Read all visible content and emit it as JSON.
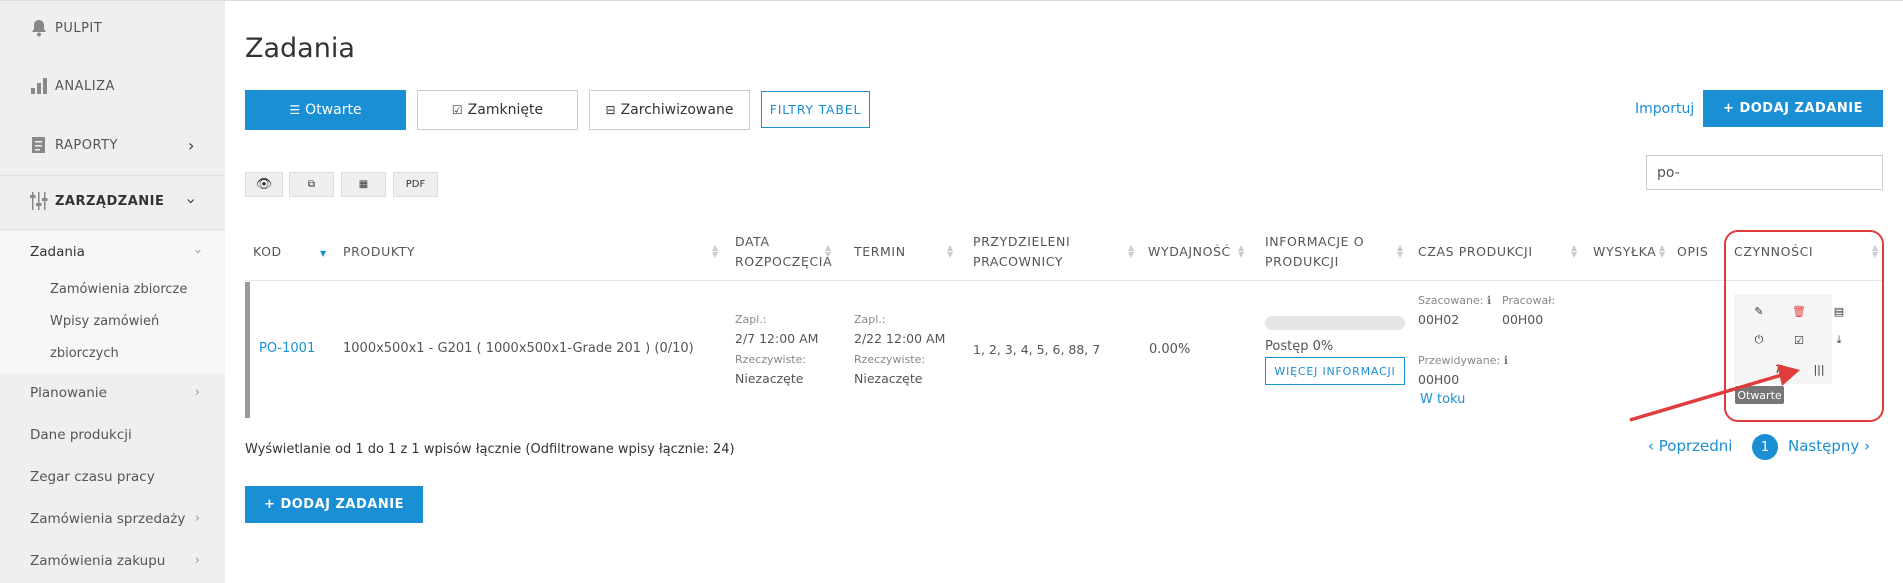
{
  "sidebar": {
    "top": [
      {
        "label": "PULPIT",
        "icon": "bell-icon"
      },
      {
        "label": "ANALIZA",
        "icon": "bar-chart-icon"
      },
      {
        "label": "RAPORTY",
        "icon": "report-icon"
      },
      {
        "label": "ZARZĄDZANIE",
        "icon": "sliders-icon"
      }
    ],
    "active_section": "Zadania",
    "sub_items": [
      "Zamówienia zbiorcze",
      "Wpisy zamówień",
      "zbiorczych"
    ],
    "items": [
      "Planowanie",
      "Dane produkcji",
      "Zegar czasu pracy",
      "Zamówienia sprzedaży",
      "Zamówienia zakupu"
    ]
  },
  "page": {
    "title": "Zadania",
    "tabs": [
      "Otwarte",
      "Zamknięte",
      "Zarchiwizowane"
    ],
    "filtry": "FILTRY TABEL",
    "importuj": "Importuj",
    "add_button": "+ DODAJ ZADANIE",
    "tools": [
      "PDF"
    ],
    "search_value": "po-"
  },
  "table": {
    "headers": [
      "KOD",
      "PRODUKTY",
      "DATA ROZPOCZĘCIA",
      "TERMIN",
      "PRZYDZIELENI PRACOWNICY",
      "WYDAJNOŚĆ",
      "INFORMACJE O PRODUKCJI",
      "CZAS PRODUKCJI",
      "WYSYŁKA",
      "OPIS",
      "CZYNNOŚCI"
    ],
    "row": {
      "kod": "PO-1001",
      "produkty": "1000x500x1 - G201 ( 1000x500x1-Grade 201 ) (0/10)",
      "start_zapl_label": "Zapl.:",
      "start_zapl": "2/7   12:00 AM",
      "start_rzecz_label": "Rzeczywiste:",
      "start_rzecz": "Niezaczęte",
      "termin_zapl_label": "Zapl.:",
      "termin_zapl": "2/22   12:00 AM",
      "termin_rzecz_label": "Rzeczywiste:",
      "termin_rzecz": "Niezaczęte",
      "pracownicy": "1, 2, 3, 4, 5, 6, 88, 7",
      "wydajnosc": "0.00%",
      "postep": "Postęp 0%",
      "postep_value": 0,
      "wiecej": "WIĘCEJ INFORMACJI",
      "szacowane_label": "Szacowane:",
      "szacowane": "00H02",
      "pracowal_label": "Pracował:",
      "pracowal": "00H00",
      "przewidywane_label": "Przewidywane:",
      "przewidywane": "00H00",
      "status": "W toku"
    },
    "tooltip": "Otwarte"
  },
  "footer": {
    "info": "Wyświetlanie od 1 do 1 z 1 wpisów łącznie (Odfiltrowane wpisy łącznie: 24)",
    "prev": "Poprzedni",
    "page": "1",
    "next": "Następny"
  },
  "colors": {
    "accent": "#1a8fd4",
    "highlight": "#e03c3c"
  }
}
